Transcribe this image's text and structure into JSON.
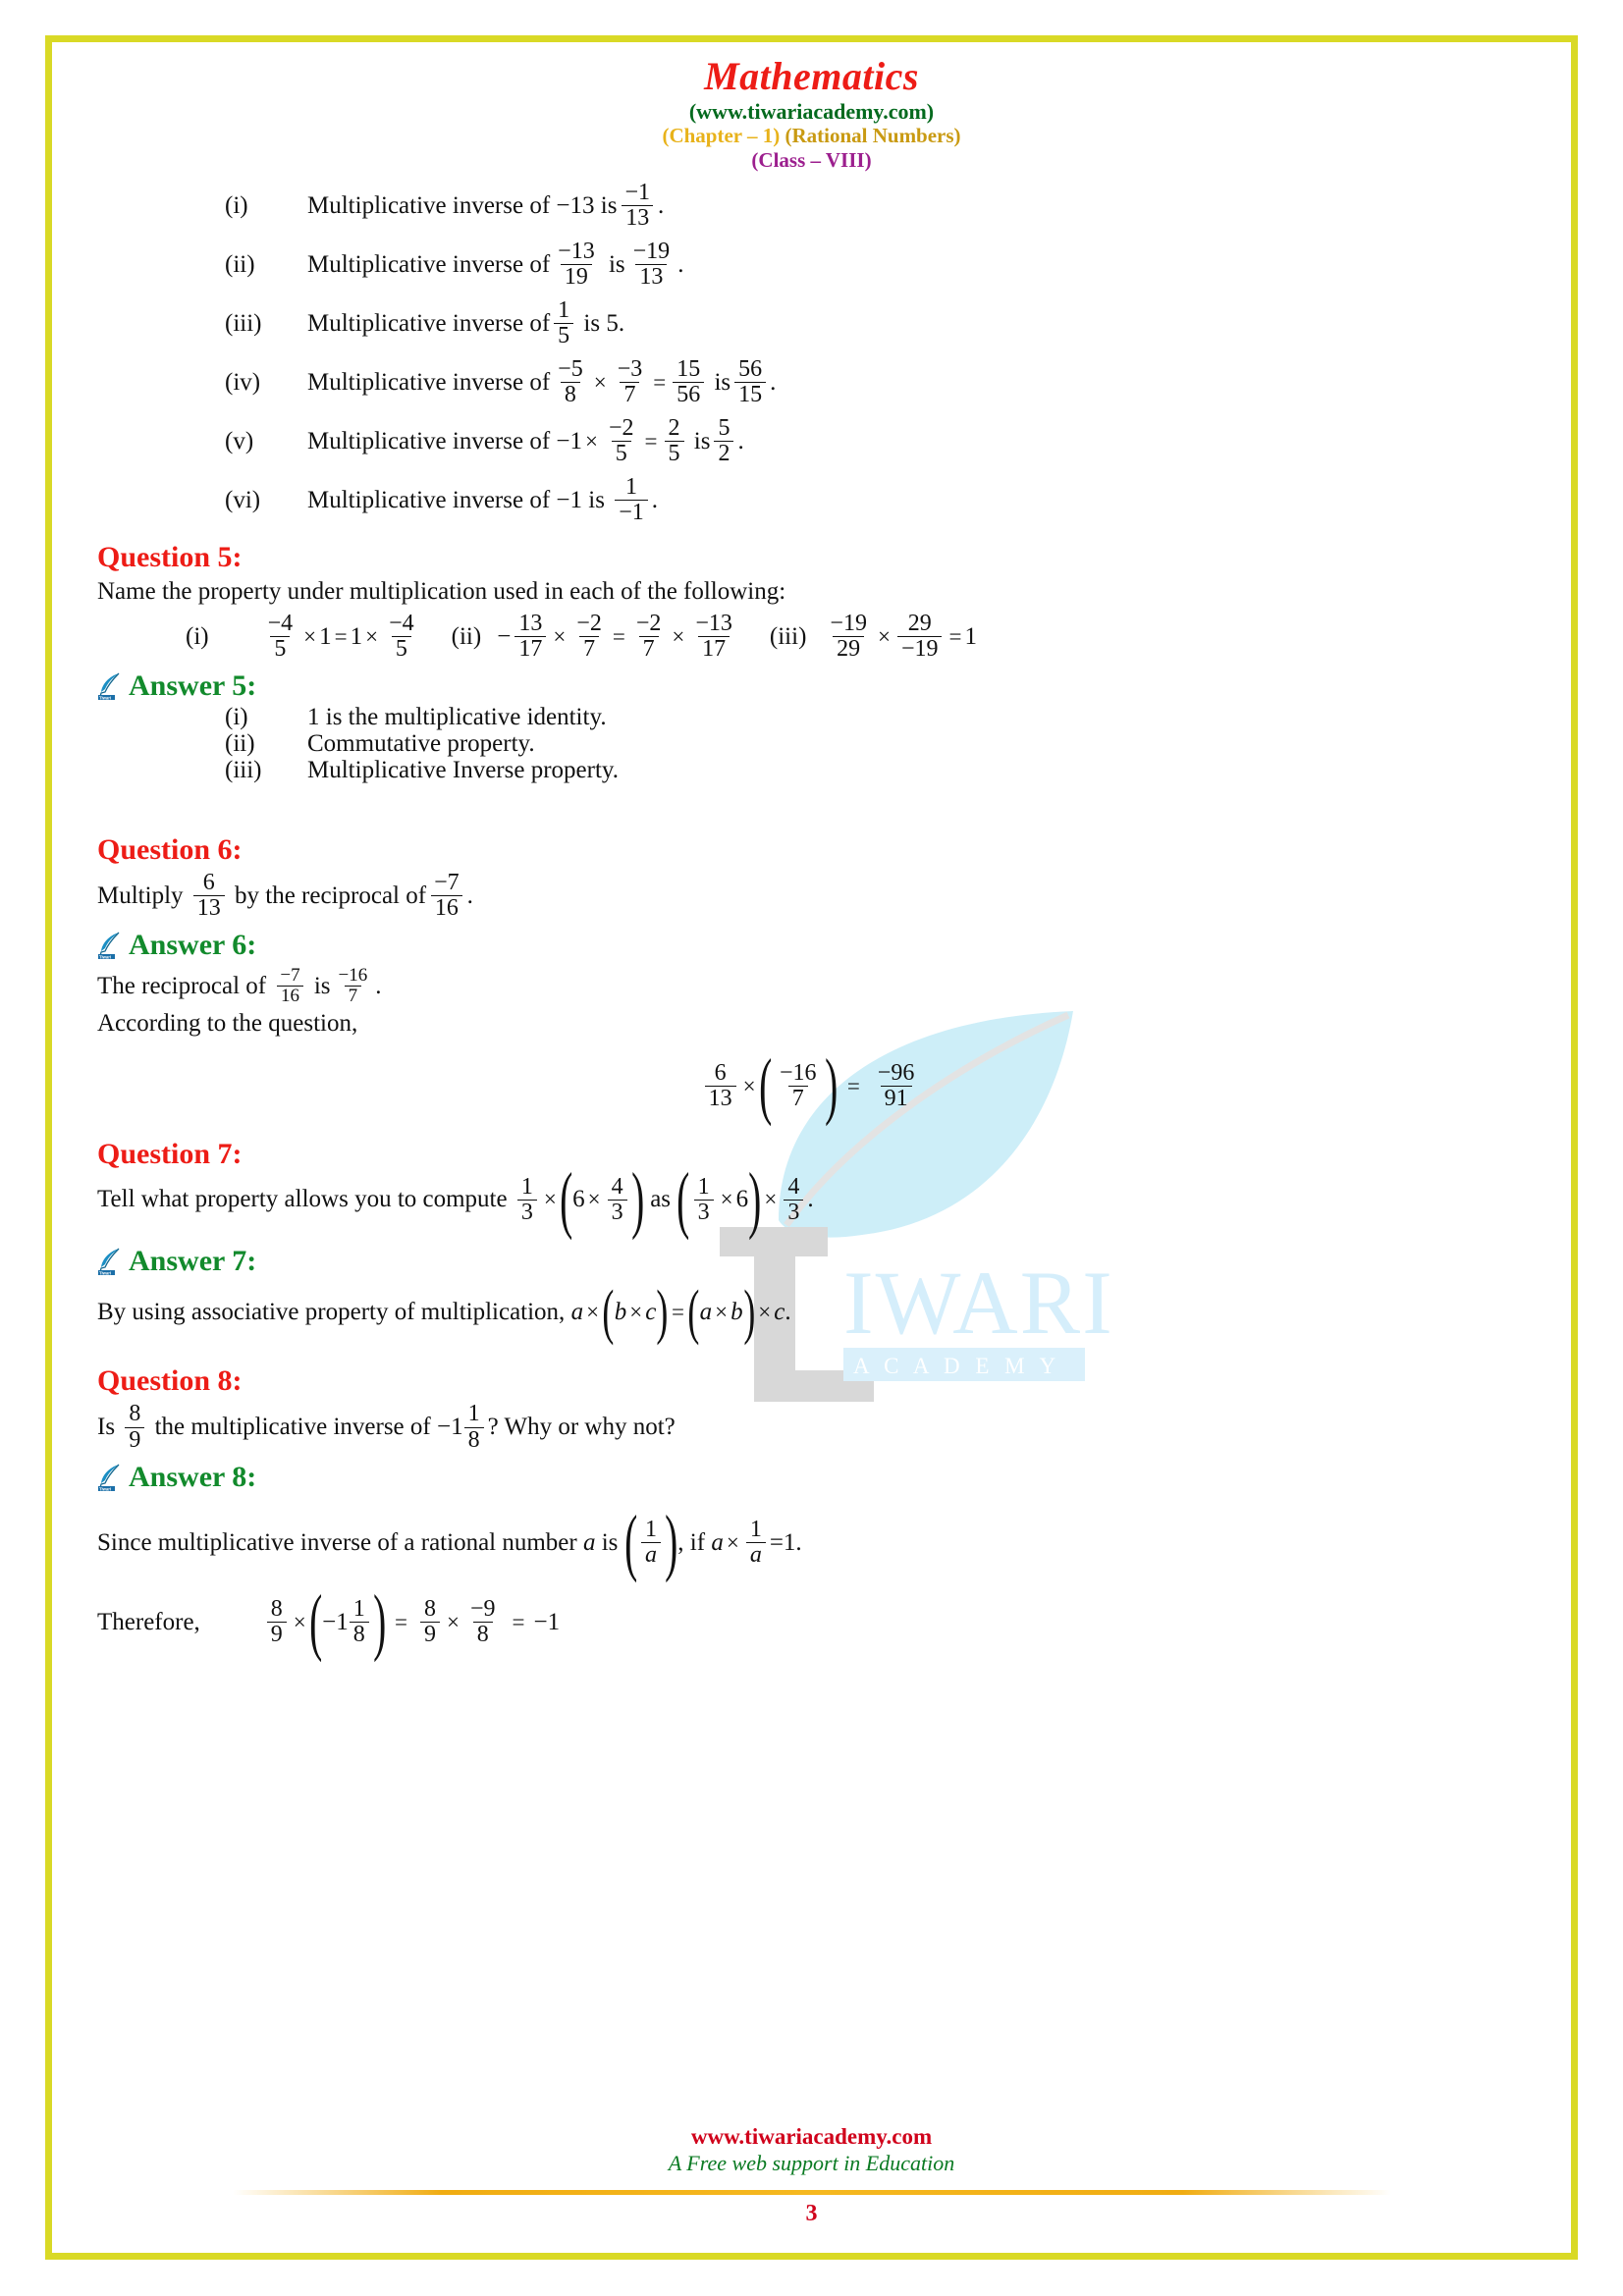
{
  "header": {
    "title": "Mathematics",
    "site": "(www.tiwariacademy.com)",
    "chapter_prefix": "(Chapter – 1)",
    "chapter_name": "(Rational Numbers)",
    "class": "(Class – VIII)"
  },
  "colors": {
    "border": "#d9d926",
    "title_red": "#ed1c16",
    "site_green": "#046a1e",
    "chapter_gold": "#e8b21a",
    "class_purple": "#9c1f8e",
    "question_red": "#ed1c16",
    "answer_green": "#128a2c",
    "footer_red": "#d0021b",
    "footer_green": "#0a7a22",
    "watermark_blue": "#cdeef8"
  },
  "answer4_items": [
    {
      "num": "(i)",
      "lead": "Multiplicative inverse of",
      "a_whole": "−13",
      "is": "is",
      "b_num": "−1",
      "b_den": "13",
      "tail": "."
    },
    {
      "num": "(ii)",
      "lead": "Multiplicative inverse of",
      "a_num": "−13",
      "a_den": "19",
      "is": "is",
      "b_num": "−19",
      "b_den": "13",
      "tail": "."
    },
    {
      "num": "(iii)",
      "lead": "Multiplicative inverse of",
      "a_num": "1",
      "a_den": "5",
      "is": "is",
      "b_whole": "5.",
      "tail": ""
    },
    {
      "num": "(iv)",
      "lead": "Multiplicative inverse of",
      "f1_num": "−5",
      "f1_den": "8",
      "times": "×",
      "f2_num": "−3",
      "f2_den": "7",
      "eq": "=",
      "f3_num": "15",
      "f3_den": "56",
      "is": "is",
      "b_num": "56",
      "b_den": "15",
      "tail": "."
    },
    {
      "num": "(v)",
      "lead": "Multiplicative inverse of",
      "pre": "−1",
      "times": "×",
      "f2_num": "−2",
      "f2_den": "5",
      "eq": "=",
      "f3_num": "2",
      "f3_den": "5",
      "is": "is",
      "b_num": "5",
      "b_den": "2",
      "tail": "."
    },
    {
      "num": "(vi)",
      "lead": "Multiplicative inverse of",
      "a_whole": "−1",
      "is": "is",
      "b_num": "1",
      "b_den": "−1",
      "tail": "."
    }
  ],
  "question5": {
    "heading": "Question 5:",
    "prompt": "Name the property under multiplication used in each of the following:",
    "parts": [
      {
        "num": "(i)",
        "f1_num": "−4",
        "f1_den": "5",
        "op1": "×",
        "v1": "1",
        "eq": "=",
        "v2": "1",
        "op2": "×",
        "f2_num": "−4",
        "f2_den": "5"
      },
      {
        "num": "(ii)",
        "minus": "−",
        "f1_num": "13",
        "f1_den": "17",
        "op1": "×",
        "f2_num": "−2",
        "f2_den": "7",
        "eq": "=",
        "f3_num": "−2",
        "f3_den": "7",
        "op2": "×",
        "f4_num": "−13",
        "f4_den": "17"
      },
      {
        "num": "(iii)",
        "f1_num": "−19",
        "f1_den": "29",
        "op1": "×",
        "f2_num": "29",
        "f2_den": "−19",
        "eq": "=",
        "result": "1"
      }
    ]
  },
  "answer5": {
    "heading": "Answer 5:",
    "items": [
      {
        "num": "(i)",
        "text": "1 is the multiplicative identity."
      },
      {
        "num": "(ii)",
        "text": "Commutative property."
      },
      {
        "num": "(iii)",
        "text": "Multiplicative Inverse property."
      }
    ]
  },
  "question6": {
    "heading": "Question 6:",
    "lead": "Multiply",
    "f1_num": "6",
    "f1_den": "13",
    "mid": "by the reciprocal of",
    "f2_num": "−7",
    "f2_den": "16",
    "tail": "."
  },
  "answer6": {
    "heading": "Answer 6:",
    "line1_lead": "The reciprocal of",
    "line1_f1_num": "−7",
    "line1_f1_den": "16",
    "line1_is": "is",
    "line1_f2_num": "−16",
    "line1_f2_den": "7",
    "line1_tail": ".",
    "line2": "According to the question,",
    "eq_f1_num": "6",
    "eq_f1_den": "13",
    "eq_times": "×",
    "eq_f2_num": "−16",
    "eq_f2_den": "7",
    "eq_equals": "=",
    "eq_res_num": "−96",
    "eq_res_den": "91"
  },
  "question7": {
    "heading": "Question 7:",
    "lead": "Tell what property allows you to compute",
    "e1_f1_num": "1",
    "e1_f1_den": "3",
    "e1_times": "×",
    "e1_inner_whole": "6",
    "e1_inner_times": "×",
    "e1_inner_num": "4",
    "e1_inner_den": "3",
    "as": "as",
    "e2_f1_num": "1",
    "e2_f1_den": "3",
    "e2_inner_times": "×",
    "e2_inner_whole": "6",
    "e2_times": "×",
    "e2_f2_num": "4",
    "e2_f2_den": "3",
    "tail": "."
  },
  "answer7": {
    "heading": "Answer 7:",
    "text": "By using associative property of multiplication,",
    "formula_a": "a",
    "formula_t1": "×",
    "formula_b": "b",
    "formula_t2": "×",
    "formula_c": "c",
    "formula_eq": "=",
    "formula_tail": "."
  },
  "question8": {
    "heading": "Question 8:",
    "lead": "Is",
    "f1_num": "8",
    "f1_den": "9",
    "mid": "the multiplicative inverse of",
    "mixed_whole": "−1",
    "mixed_num": "1",
    "mixed_den": "8",
    "tail": "? Why or why not?"
  },
  "answer8": {
    "heading": "Answer 8:",
    "line1_a": "Since multiplicative inverse of a rational number",
    "line1_var": "a",
    "line1_b": "is",
    "line1_f_num": "1",
    "line1_f_den": "a",
    "line1_c": ", if",
    "line1_var2": "a",
    "line1_times": "×",
    "line1_f2_num": "1",
    "line1_f2_den": "a",
    "line1_eq": "=1.",
    "therefore": "Therefore,",
    "t_f1_num": "8",
    "t_f1_den": "9",
    "t_times": "×",
    "t_mixed_whole": "−1",
    "t_mixed_num": "1",
    "t_mixed_den": "8",
    "t_eq1": "=",
    "t_f2_num": "8",
    "t_f2_den": "9",
    "t_times2": "×",
    "t_f3_num": "−9",
    "t_f3_den": "8",
    "t_eq2": "=",
    "t_result": "−1"
  },
  "watermark": {
    "brand": "IWARI",
    "sub": "A C A D E M Y"
  },
  "footer": {
    "site": "www.tiwariacademy.com",
    "tagline": "A Free web support in Education",
    "page": "3"
  }
}
